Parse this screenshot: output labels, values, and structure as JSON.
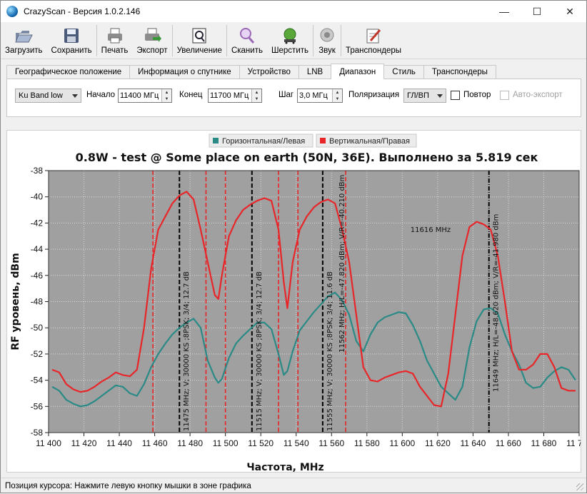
{
  "window": {
    "title": "CrazyScan - Версия 1.0.2.146",
    "minimize": "—",
    "maximize": "☐",
    "close": "✕"
  },
  "toolbar": {
    "load": "Загрузить",
    "save": "Сохранить",
    "print": "Печать",
    "export": "Экспорт",
    "zoom": "Увеличение",
    "scan": "Сканить",
    "scour": "Шерстить",
    "sound": "Звук",
    "transponders": "Транспондеры"
  },
  "tabs": [
    {
      "label": "Географическое положение"
    },
    {
      "label": "Информация о спутнике"
    },
    {
      "label": "Устройство"
    },
    {
      "label": "LNB"
    },
    {
      "label": "Диапазон",
      "active": true
    },
    {
      "label": "Стиль"
    },
    {
      "label": "Транспондеры"
    }
  ],
  "range_panel": {
    "band": "Ku Band low",
    "start_label": "Начало",
    "start_value": "11400 МГц",
    "end_label": "Конец",
    "end_value": "11700 МГц",
    "step_label": "Шаг",
    "step_value": "3,0 МГц",
    "polarization_label": "Поляризация",
    "polarization_value": "ГЛ/ВП",
    "repeat_label": "Повтор",
    "auto_export_label": "Авто-экспорт"
  },
  "chart_data": {
    "type": "line",
    "title": "0.8W - test @ Some place on earth (50N, 36E). Выполнено за 5.819 сек",
    "xlabel": "Частота, MHz",
    "ylabel": "RF уровень, dBm",
    "xlim": [
      11400,
      11700
    ],
    "ylim": [
      -58,
      -38
    ],
    "xticks": [
      11400,
      11420,
      11440,
      11460,
      11480,
      11500,
      11520,
      11540,
      11560,
      11580,
      11600,
      11620,
      11640,
      11660,
      11680,
      11700
    ],
    "xtick_labels": [
      "11 400",
      "11 420",
      "11 440",
      "11 460",
      "11 480",
      "11 500",
      "11 520",
      "11 540",
      "11 560",
      "11 580",
      "11 600",
      "11 620",
      "11 640",
      "11 660",
      "11 680",
      "11 700"
    ],
    "yticks": [
      -38,
      -40,
      -42,
      -44,
      -46,
      -48,
      -50,
      -52,
      -54,
      -56,
      -58
    ],
    "grid": true,
    "legend": "top-center",
    "plot_bg": "#a0a0a0",
    "series": [
      {
        "name": "Горизонтальная/Левая",
        "color": "#2a8a86",
        "x": [
          11402,
          11406,
          11410,
          11414,
          11418,
          11422,
          11426,
          11430,
          11434,
          11438,
          11442,
          11446,
          11450,
          11454,
          11458,
          11462,
          11466,
          11470,
          11474,
          11478,
          11482,
          11486,
          11490,
          11494,
          11496,
          11498,
          11502,
          11506,
          11510,
          11514,
          11518,
          11522,
          11526,
          11530,
          11533,
          11535,
          11538,
          11542,
          11546,
          11550,
          11554,
          11558,
          11562,
          11566,
          11570,
          11574,
          11578,
          11582,
          11586,
          11590,
          11594,
          11598,
          11602,
          11606,
          11610,
          11614,
          11618,
          11622,
          11626,
          11630,
          11634,
          11638,
          11642,
          11646,
          11650,
          11654,
          11658,
          11662,
          11666,
          11670,
          11674,
          11678,
          11682,
          11686,
          11690,
          11694,
          11698
        ],
        "y": [
          -54.5,
          -54.8,
          -55.5,
          -55.8,
          -56.0,
          -55.9,
          -55.6,
          -55.2,
          -54.8,
          -54.4,
          -54.5,
          -55.0,
          -55.2,
          -54.3,
          -53.0,
          -52.0,
          -51.2,
          -50.5,
          -50.0,
          -49.6,
          -49.3,
          -50.0,
          -52.5,
          -53.8,
          -54.2,
          -53.9,
          -52.3,
          -51.2,
          -50.6,
          -50.1,
          -49.6,
          -49.6,
          -50.1,
          -52.0,
          -53.6,
          -53.3,
          -51.8,
          -50.2,
          -49.5,
          -48.8,
          -48.2,
          -47.6,
          -47.3,
          -47.9,
          -49.0,
          -51.0,
          -51.8,
          -50.5,
          -49.6,
          -49.2,
          -49.0,
          -48.8,
          -48.9,
          -49.8,
          -51.0,
          -52.5,
          -53.5,
          -54.5,
          -55.0,
          -55.5,
          -54.5,
          -51.5,
          -49.5,
          -48.6,
          -48.5,
          -48.9,
          -50.5,
          -51.8,
          -52.8,
          -54.2,
          -54.6,
          -54.5,
          -53.8,
          -53.3,
          -53.0,
          -53.2,
          -54.0
        ]
      },
      {
        "name": "Вертикальная/Правая",
        "color": "#e8262a",
        "x": [
          11402,
          11406,
          11410,
          11414,
          11418,
          11422,
          11426,
          11430,
          11434,
          11438,
          11442,
          11446,
          11450,
          11454,
          11458,
          11462,
          11466,
          11470,
          11474,
          11478,
          11482,
          11486,
          11490,
          11494,
          11496,
          11498,
          11502,
          11506,
          11510,
          11514,
          11518,
          11522,
          11526,
          11530,
          11533,
          11535,
          11538,
          11542,
          11546,
          11550,
          11554,
          11558,
          11562,
          11566,
          11570,
          11574,
          11578,
          11582,
          11586,
          11590,
          11594,
          11598,
          11602,
          11606,
          11610,
          11614,
          11618,
          11622,
          11626,
          11630,
          11634,
          11638,
          11642,
          11646,
          11650,
          11654,
          11658,
          11662,
          11666,
          11670,
          11674,
          11678,
          11682,
          11686,
          11690,
          11694,
          11698
        ],
        "y": [
          -53.2,
          -53.4,
          -54.3,
          -54.7,
          -54.9,
          -54.8,
          -54.5,
          -54.1,
          -53.8,
          -53.4,
          -53.6,
          -53.7,
          -53.2,
          -50.0,
          -45.5,
          -42.5,
          -41.5,
          -40.5,
          -39.9,
          -39.6,
          -40.2,
          -42.5,
          -45.0,
          -47.5,
          -47.8,
          -46.0,
          -43.0,
          -41.8,
          -41.0,
          -40.6,
          -40.3,
          -40.1,
          -40.3,
          -42.5,
          -46.5,
          -48.5,
          -45.0,
          -42.5,
          -41.5,
          -40.8,
          -40.4,
          -40.2,
          -40.5,
          -42.5,
          -45.0,
          -49.0,
          -53.0,
          -54.0,
          -54.1,
          -53.8,
          -53.6,
          -53.4,
          -53.3,
          -53.5,
          -54.5,
          -55.2,
          -55.9,
          -56.0,
          -53.5,
          -49.0,
          -44.5,
          -42.3,
          -41.9,
          -42.1,
          -42.5,
          -44.5,
          -48.0,
          -51.8,
          -53.2,
          -53.2,
          -52.8,
          -52.0,
          -52.0,
          -53.0,
          -54.6,
          -54.8,
          -54.8
        ]
      }
    ],
    "markers": [
      {
        "x": 11459,
        "color": "#e8262a",
        "style": "dash"
      },
      {
        "x": 11474,
        "color": "#000000",
        "style": "dash"
      },
      {
        "x": 11489,
        "color": "#e8262a",
        "style": "dash"
      },
      {
        "x": 11500,
        "color": "#e8262a",
        "style": "dash"
      },
      {
        "x": 11515,
        "color": "#000000",
        "style": "dash"
      },
      {
        "x": 11530,
        "color": "#e8262a",
        "style": "dash"
      },
      {
        "x": 11541,
        "color": "#e8262a",
        "style": "dash"
      },
      {
        "x": 11555,
        "color": "#000000",
        "style": "dash"
      },
      {
        "x": 11568,
        "color": "#e8262a",
        "style": "dash"
      },
      {
        "x": 11649,
        "color": "#000000",
        "style": "dashdot"
      }
    ],
    "annotations": [
      {
        "text": "11475 MHz; V; 30000 KS ;8PSK; 3/4; 12.7 dB",
        "x": 11476,
        "y": -58,
        "rotate": true
      },
      {
        "text": "11515 MHz; V; 30000 KS ;8PSK; 3/4; 12.7 dB",
        "x": 11517,
        "y": -58,
        "rotate": true
      },
      {
        "text": "11555 MHz; V; 30000 KS ;8PSK; 3/4; 11.6 dB",
        "x": 11557,
        "y": -58,
        "rotate": true
      },
      {
        "text": "11562 MHz; H/L=-47.820 dBm; V/R=-40.210 dBm",
        "x": 11564,
        "y": -52,
        "rotate": true
      },
      {
        "text": "11649 MHz; H/L=-48.620 dBm; V/R=-41.980 dBm",
        "x": 11651,
        "y": -55,
        "rotate": true
      },
      {
        "text": "11616 MHz",
        "x": 11616,
        "y": -42.7,
        "rotate": false
      }
    ]
  },
  "status": {
    "text": "Позиция курсора: Нажмите левую кнопку мышки в зоне графика"
  }
}
